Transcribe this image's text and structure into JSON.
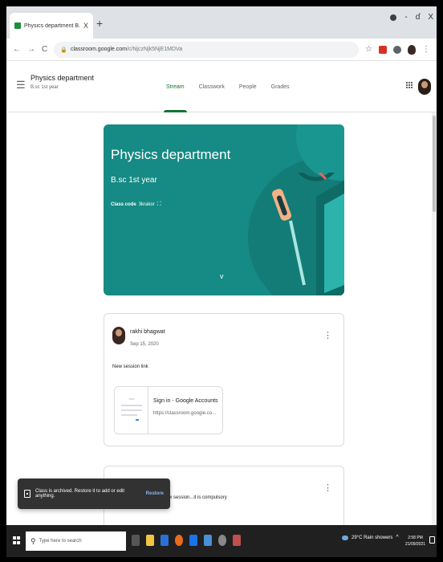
{
  "browser": {
    "tab_title": "Physics department B.sc 1st year",
    "tab_close": "X",
    "new_tab": "+",
    "nav_back": "←",
    "nav_forward": "→",
    "nav_reload": "C",
    "url_host": "classroom.google.com",
    "url_path": "/c/NjczNjk5NjE1MDVa",
    "window_minimize": "-",
    "window_restore": "ɗ",
    "window_close": "X"
  },
  "classroom": {
    "class_name": "Physics department",
    "section": "B.sc 1st year",
    "tabs": [
      {
        "label": "Stream",
        "active": true
      },
      {
        "label": "Classwork",
        "active": false
      },
      {
        "label": "People",
        "active": false
      },
      {
        "label": "Grades",
        "active": false
      }
    ]
  },
  "banner": {
    "title": "Physics department",
    "subtitle": "B.sc 1st year",
    "class_code_label": "Class code",
    "class_code_value": "3krakor",
    "color": "#168a84"
  },
  "posts": [
    {
      "author": "rakhi bhagwat",
      "date": "Sep 15, 2020",
      "text": "New session link",
      "attachment": {
        "title": "Sign in - Google Accounts",
        "url": "https://classroom.google.co..."
      }
    },
    {
      "text": "Dear students join your new session...it is compulsory"
    }
  ],
  "snackbar": {
    "message": "Class is archived. Restore it to add or edit anything.",
    "action": "Restore"
  },
  "taskbar": {
    "search_placeholder": "Type here to search",
    "weather": "29°C  Rain showers",
    "time": "2:58 PM",
    "date": "21/09/2021"
  },
  "colors": {
    "accent": "#137333",
    "banner": "#168a84",
    "snackbar": "#323232",
    "taskbar": "#202020"
  },
  "icons": [
    "hamburger-icon",
    "apps-icon",
    "more-vert-icon",
    "expand-icon",
    "chevron-down-icon",
    "archive-icon",
    "windows-icon",
    "search-icon"
  ]
}
